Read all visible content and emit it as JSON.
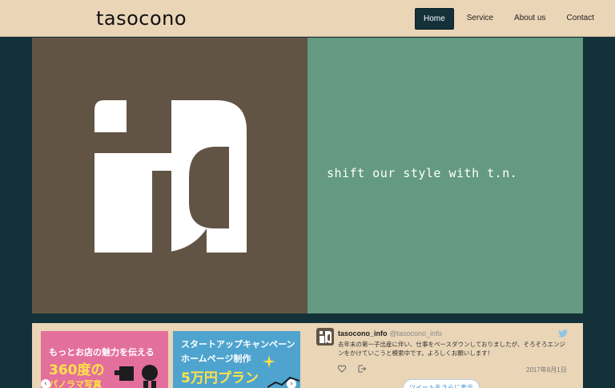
{
  "brand": "tasocono",
  "nav": {
    "items": [
      {
        "label": "Home",
        "active": true
      },
      {
        "label": "Service",
        "active": false
      },
      {
        "label": "About us",
        "active": false
      },
      {
        "label": "Contact",
        "active": false
      }
    ]
  },
  "hero": {
    "tagline": "shift our style with t.n.",
    "logo_icon": "ta-logo-mark"
  },
  "banners": [
    {
      "lines": [
        "もっとお店の魅力を伝える",
        "360度の",
        "パノラマ写真"
      ]
    },
    {
      "lines": [
        "スタートアップキャンペーン",
        "ホームページ制作",
        "5万円プラン"
      ]
    }
  ],
  "tweet": {
    "name": "tasocono_info",
    "handle": "@tasocono_info",
    "text": "去年末の第一子出産に伴い、仕事をペースダウンしておりましたが、そろそろエンジンをかけていこうと模索中です。よろしくお願いします！",
    "date": "2017年8月1日",
    "more_label": "ツイートをさらに表示"
  },
  "colors": {
    "header_bg": "#ead5b7",
    "page_bg": "#14313a",
    "hero_left": "#625444",
    "hero_right": "#649a81",
    "accent": "#ffe14a"
  }
}
